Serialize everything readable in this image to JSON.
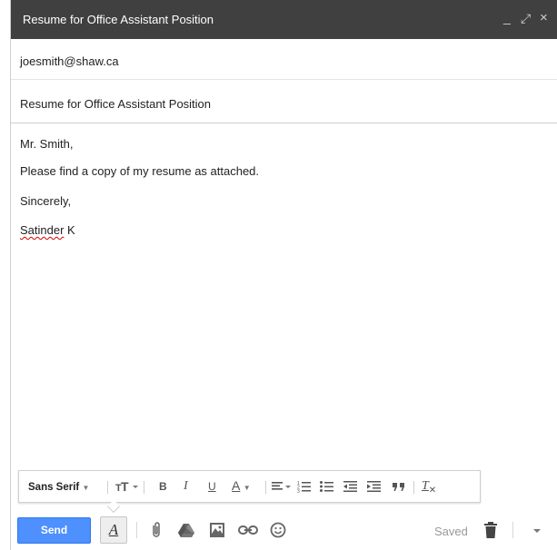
{
  "window": {
    "title": "Resume for Office Assistant Position",
    "controls": {
      "minimize": "_",
      "expand": "⤢",
      "close": "×"
    }
  },
  "to": {
    "value": "joesmith@shaw.ca"
  },
  "subject": {
    "value": "Resume for Office Assistant Position"
  },
  "body": {
    "greeting": "Mr. Smith,",
    "line": "Please find a copy of my resume as attached.",
    "closing": "Sincerely,",
    "signature_first": "Satinder",
    "signature_rest": " K"
  },
  "formatting_toolbar": {
    "font": "Sans Serif",
    "bold": "B",
    "italic": "I",
    "underline": "U",
    "text_color": "A",
    "remove_formatting": "T"
  },
  "bottom_toolbar": {
    "send_label": "Send",
    "formatting_toggle": "A",
    "saved_label": "Saved"
  },
  "icons": [
    "minimize-icon",
    "expand-icon",
    "close-icon",
    "attach-icon",
    "drive-icon",
    "photo-icon",
    "link-icon",
    "emoji-icon",
    "trash-icon",
    "more-options-icon"
  ],
  "colors": {
    "titlebar": "#404040",
    "send_button": "#4d90fe",
    "spellcheck": "#d40000"
  }
}
